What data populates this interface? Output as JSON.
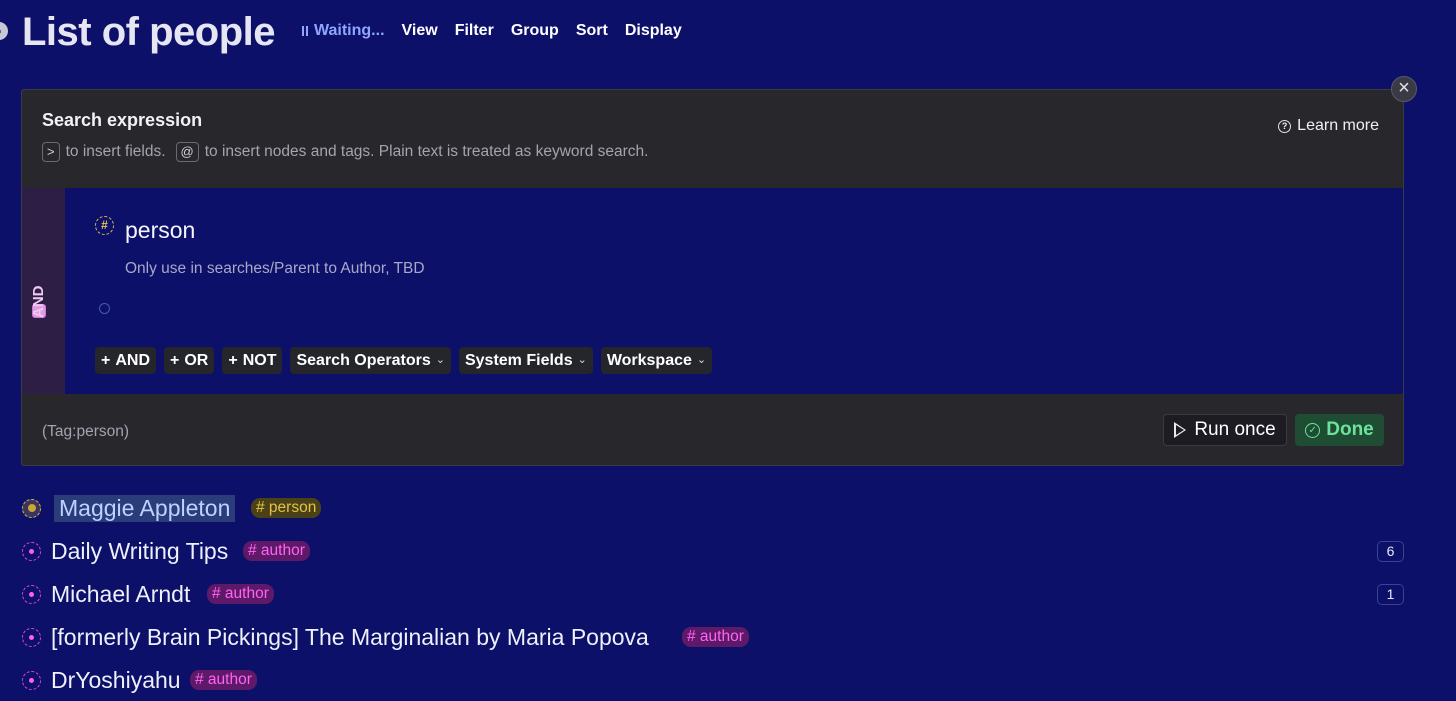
{
  "header": {
    "title": "List of people",
    "status": "Waiting...",
    "toolbar": [
      "View",
      "Filter",
      "Group",
      "Sort",
      "Display"
    ]
  },
  "search_panel": {
    "title": "Search expression",
    "hint_key_fields": ">",
    "hint_fields_text": "to insert fields.",
    "hint_key_nodes": "@",
    "hint_nodes_text": "to insert nodes and tags. Plain text is treated as keyword search.",
    "learn_more": "Learn more",
    "group_operator": "AND",
    "tag_glyph": "#",
    "tag_name": "person",
    "tag_description": "Only use in searches/Parent to Author, TBD",
    "operator_buttons": [
      "AND",
      "OR",
      "NOT"
    ],
    "dropdowns": [
      "Search Operators",
      "System Fields",
      "Workspace"
    ],
    "query_text": "(Tag:person)",
    "run_once": "Run once",
    "done": "Done"
  },
  "results": [
    {
      "name": "Maggie Appleton",
      "tag": "# person",
      "tag_type": "person",
      "count": "",
      "selected": true
    },
    {
      "name": "Daily Writing Tips",
      "tag": "# author",
      "tag_type": "author",
      "count": "6",
      "selected": false
    },
    {
      "name": "Michael Arndt",
      "tag": "# author",
      "tag_type": "author",
      "count": "1",
      "selected": false
    },
    {
      "name": "[formerly Brain Pickings] The Marginalian by Maria Popova",
      "tag": "# author",
      "tag_type": "author",
      "count": "",
      "selected": false
    },
    {
      "name": "DrYoshiyahu",
      "tag": "# author",
      "tag_type": "author",
      "count": "",
      "selected": false
    }
  ],
  "colors": {
    "background": "#0c1069",
    "panel": "#27272c",
    "accent_tag_person": "#e2c24a",
    "accent_tag_author": "#ff63f2",
    "done_green": "#6ce29a"
  }
}
